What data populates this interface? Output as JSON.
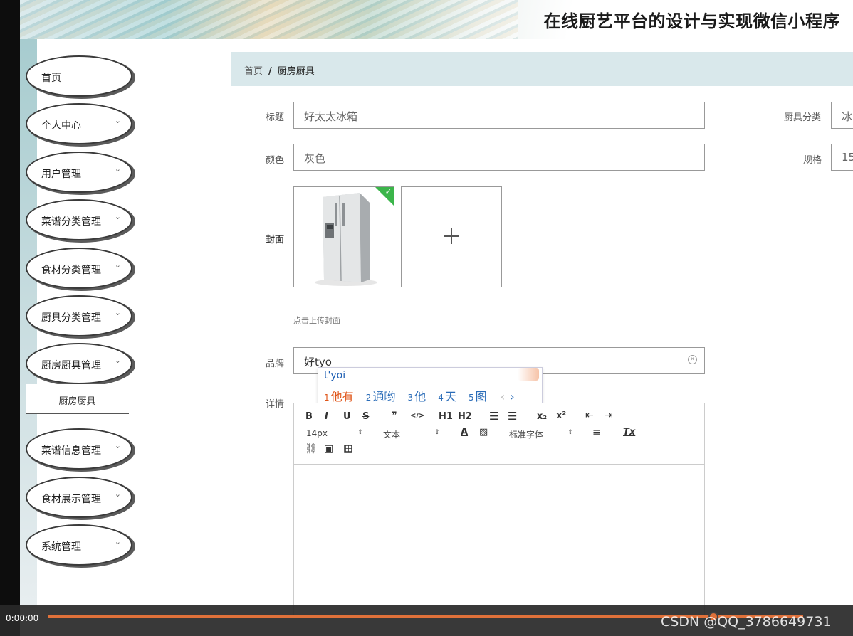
{
  "header": {
    "title": "在线厨艺平台的设计与实现微信小程序"
  },
  "sidebar": {
    "items": [
      {
        "label": "首页"
      },
      {
        "label": "个人中心"
      },
      {
        "label": "用户管理"
      },
      {
        "label": "菜谱分类管理"
      },
      {
        "label": "食材分类管理"
      },
      {
        "label": "厨具分类管理"
      },
      {
        "label": "厨房厨具管理"
      },
      {
        "label": "菜谱信息管理"
      },
      {
        "label": "食材展示管理"
      },
      {
        "label": "系统管理"
      }
    ],
    "submenu_active": "厨房厨具"
  },
  "breadcrumb": {
    "home": "首页",
    "separator": "/",
    "current": "厨房厨具"
  },
  "form": {
    "title_label": "标题",
    "title_value": "好太太冰箱",
    "color_label": "颜色",
    "color_value": "灰色",
    "category_label": "厨具分类",
    "category_value": "冰",
    "spec_label": "规格",
    "spec_value": "15",
    "cover_label": "封面",
    "cover_hint": "点击上传封面",
    "brand_label": "品牌",
    "brand_value": "好tyo",
    "detail_label": "详情"
  },
  "ime": {
    "pinyin": "t'yoi",
    "candidates": [
      {
        "n": "1",
        "text": "他有"
      },
      {
        "n": "2",
        "text": "通哟"
      },
      {
        "n": "3",
        "text": "他"
      },
      {
        "n": "4",
        "text": "天"
      },
      {
        "n": "5",
        "text": "图"
      }
    ]
  },
  "editor": {
    "font_size": "14px",
    "text_type": "文本",
    "font_family": "标准字体",
    "buttons": [
      "B",
      "I",
      "U",
      "S",
      "❞",
      "</>",
      "H1",
      "H2",
      "ol",
      "ul",
      "x₂",
      "x²",
      "outdent",
      "indent",
      "A",
      "bg",
      "align",
      "Tx",
      "link",
      "image",
      "video"
    ]
  },
  "video": {
    "time": "0:00:00",
    "progress": 0.88,
    "watermark": "CSDN @QQ_3786649731"
  },
  "colors": {
    "accent": "#e0713a",
    "breadcrumb_bg": "#d9e8eb",
    "check": "#3bb54a"
  }
}
